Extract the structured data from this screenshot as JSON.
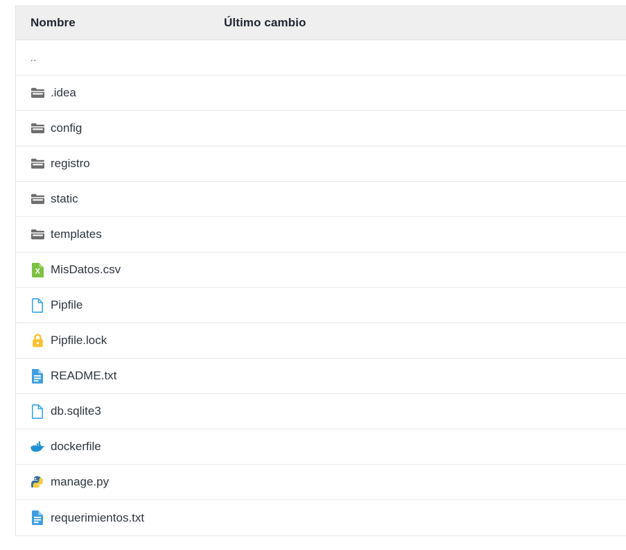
{
  "file_browser": {
    "columns": {
      "name": "Nombre",
      "last_modified": "Último cambio"
    },
    "colors": {
      "header_background": "#efefef",
      "row_border": "#e9e9e9",
      "frame_border": "#e3e3e3",
      "text": "#2d3440",
      "header_text": "#1f2430",
      "folder_icon": "#6d6d6d",
      "csv_icon": "#7cc142",
      "file_outline_icon": "#39a5e8",
      "lock_icon": "#fbc02d",
      "text_file_icon": "#3f9fe0",
      "docker_icon": "#1d91d0",
      "python_blue": "#386e9e",
      "python_yellow": "#f5cb3f"
    },
    "rows": [
      {
        "icon": "parent-directory",
        "name": "..",
        "last_modified": ""
      },
      {
        "icon": "folder-icon",
        "name": ".idea",
        "last_modified": ""
      },
      {
        "icon": "folder-icon",
        "name": "config",
        "last_modified": ""
      },
      {
        "icon": "folder-icon",
        "name": "registro",
        "last_modified": ""
      },
      {
        "icon": "folder-icon",
        "name": "static",
        "last_modified": ""
      },
      {
        "icon": "folder-icon",
        "name": "templates",
        "last_modified": ""
      },
      {
        "icon": "csv-file-icon",
        "name": "MisDatos.csv",
        "last_modified": ""
      },
      {
        "icon": "blank-file-icon",
        "name": "Pipfile",
        "last_modified": ""
      },
      {
        "icon": "lock-file-icon",
        "name": "Pipfile.lock",
        "last_modified": ""
      },
      {
        "icon": "text-file-icon",
        "name": "README.txt",
        "last_modified": ""
      },
      {
        "icon": "blank-file-icon",
        "name": "db.sqlite3",
        "last_modified": ""
      },
      {
        "icon": "docker-file-icon",
        "name": "dockerfile",
        "last_modified": ""
      },
      {
        "icon": "python-file-icon",
        "name": "manage.py",
        "last_modified": ""
      },
      {
        "icon": "text-file-icon",
        "name": "requerimientos.txt",
        "last_modified": ""
      }
    ]
  }
}
